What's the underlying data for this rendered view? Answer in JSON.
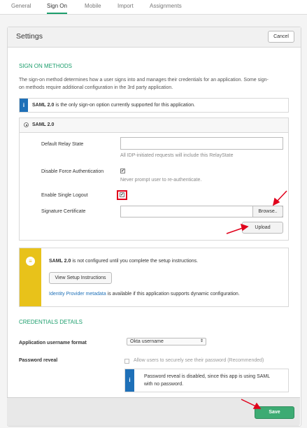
{
  "tabs": [
    {
      "label": "General"
    },
    {
      "label": "Sign On"
    },
    {
      "label": "Mobile"
    },
    {
      "label": "Import"
    },
    {
      "label": "Assignments"
    }
  ],
  "settings": {
    "title": "Settings",
    "cancel_label": "Cancel"
  },
  "sign_on": {
    "title": "SIGN ON METHODS",
    "description_line1": "The sign-on method determines how a user signs into and manages their credentials for an application. Some sign-",
    "description_line2": "on methods require additional configuration in the 3rd party application.",
    "info_bold": "SAML 2.0",
    "info_rest": " is the only sign-on option currently supported for this application.",
    "method_label": "SAML 2.0",
    "relay_label": "Default Relay State",
    "relay_value": "",
    "relay_hint": "All IDP-initiated requests will include this RelayState",
    "disable_force_label": "Disable Force Authentication",
    "disable_force_hint": "Never prompt user to re-authenticate.",
    "single_logout_label": "Enable Single Logout",
    "cert_label": "Signature Certificate",
    "cert_value": "",
    "browse_label": "Browse..",
    "upload_label": "Upload"
  },
  "setup_box": {
    "bold": "SAML 2.0",
    "rest": " is not configured until you complete the setup instructions.",
    "button_label": "View Setup Instructions",
    "link_text": "Identity Provider metadata",
    "link_rest": " is available if this application supports dynamic configuration."
  },
  "credentials": {
    "title": "CREDENTIALS DETAILS",
    "format_label": "Application username format",
    "format_value": "Okta username",
    "reveal_label": "Password reveal",
    "reveal_option": "Allow users to securely see their password (Recommended)",
    "reveal_info_line1": "Password reveal is disabled, since this app is using SAML",
    "reveal_info_line2": "with no password."
  },
  "footer": {
    "save_label": "Save"
  },
  "colors": {
    "accent_green": "#1c9e6c",
    "info_blue": "#1e70b8",
    "warning_yellow": "#e8c21a",
    "annotation_red": "#e0001b",
    "save_green": "#3dab73"
  },
  "icons": {
    "info": "info-icon",
    "setup": "list-icon",
    "select": "updown-arrow-icon"
  }
}
